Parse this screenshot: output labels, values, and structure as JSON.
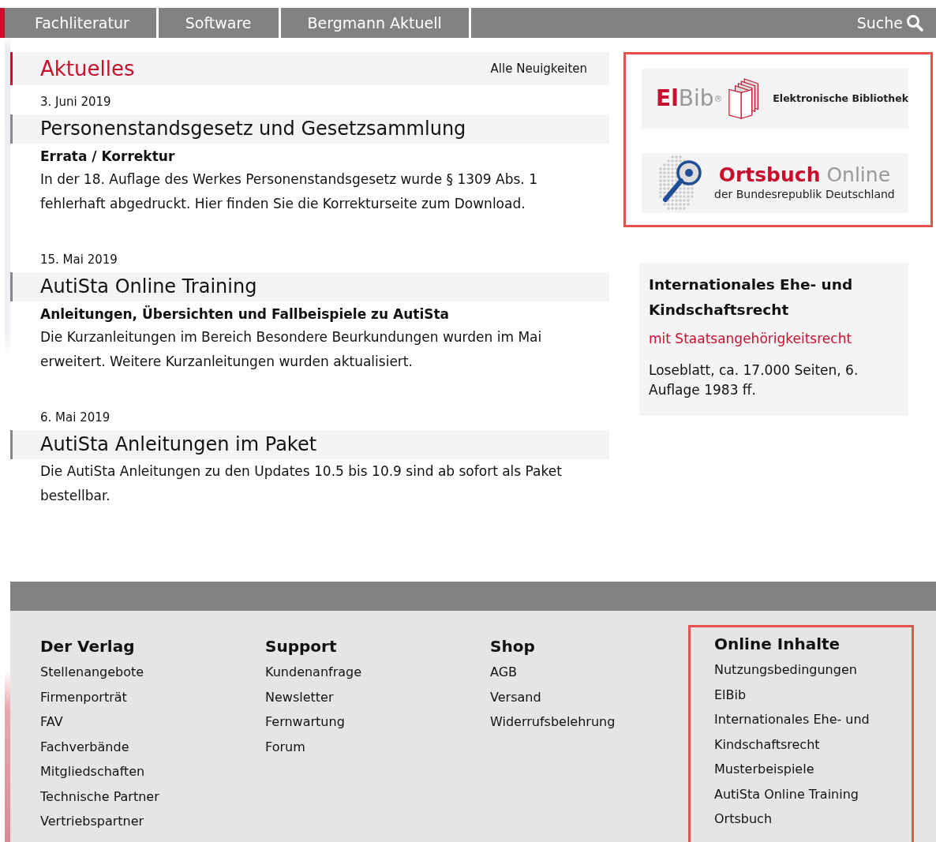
{
  "nav": {
    "items": [
      {
        "label": "Fachliteratur"
      },
      {
        "label": "Software"
      },
      {
        "label": "Bergmann Aktuell"
      }
    ],
    "search": {
      "label": "Suche"
    }
  },
  "news": {
    "title": "Aktuelles",
    "link_label": "Alle Neuigkeiten",
    "articles": [
      {
        "date": "3. Juni 2019",
        "title": "Personenstandsgesetz und Gesetzsammlung",
        "subtitle": "Errata / Korrektur",
        "text": "In der 18. Auflage des Werkes Personenstandsgesetz wurde § 1309 Abs. 1 fehlerhaft abgedruckt. Hier finden Sie die Korrekturseite zum Download."
      },
      {
        "date": "15. Mai 2019",
        "title": "AutiSta Online Training",
        "subtitle": "Anleitungen, Übersichten und Fallbeispiele zu AutiSta",
        "text": "Die Kurzanleitungen im Bereich Besondere Beurkundungen wurden im Mai erweitert. Weitere Kurzanleitungen wurden aktualisiert."
      },
      {
        "date": "6. Mai 2019",
        "title": "AutiSta Anleitungen im Paket",
        "text": "Die AutiSta Anleitungen zu den Updates 10.5 bis 10.9 sind ab sofort als Paket bestellbar."
      }
    ]
  },
  "logos": {
    "highlighted": true,
    "items": [
      {
        "kind": "elbib",
        "brand_a": "El",
        "brand_b": "Bib",
        "mark": "®",
        "caption": "Elektronische Bibliothek"
      },
      {
        "kind": "ortsbuch",
        "brand_a": "Ortsbuch",
        "brand_b": "Online",
        "caption": "der Bundesrepublik Deutschland"
      }
    ]
  },
  "info_box": {
    "title": "Internationales Ehe- und Kindschaftsrecht",
    "subtitle": "mit Staatsangehörigkeitsrecht",
    "text": "Loseblatt, ca. 17.000 Seiten, 6. Auflage 1983 ff."
  },
  "footer": {
    "columns": [
      {
        "title": "Der Verlag",
        "highlighted": false,
        "links": [
          "Stellenangebote",
          "Firmenporträt",
          "FAV",
          "Fachverbände",
          "Mitgliedschaften",
          "Technische Partner",
          "Vertriebspartner"
        ]
      },
      {
        "title": "Support",
        "highlighted": false,
        "links": [
          "Kundenanfrage",
          "Newsletter",
          "Fernwartung",
          "Forum"
        ]
      },
      {
        "title": "Shop",
        "highlighted": false,
        "links": [
          "AGB",
          "Versand",
          "Widerrufsbelehrung"
        ]
      },
      {
        "title": "Online Inhalte",
        "highlighted": true,
        "links": [
          "Nutzungsbedingungen",
          "ElBib",
          "Internationales Ehe- und Kindschaftsrecht",
          "Musterbeispiele",
          "AutiSta Online Training",
          "Ortsbuch"
        ]
      }
    ]
  }
}
